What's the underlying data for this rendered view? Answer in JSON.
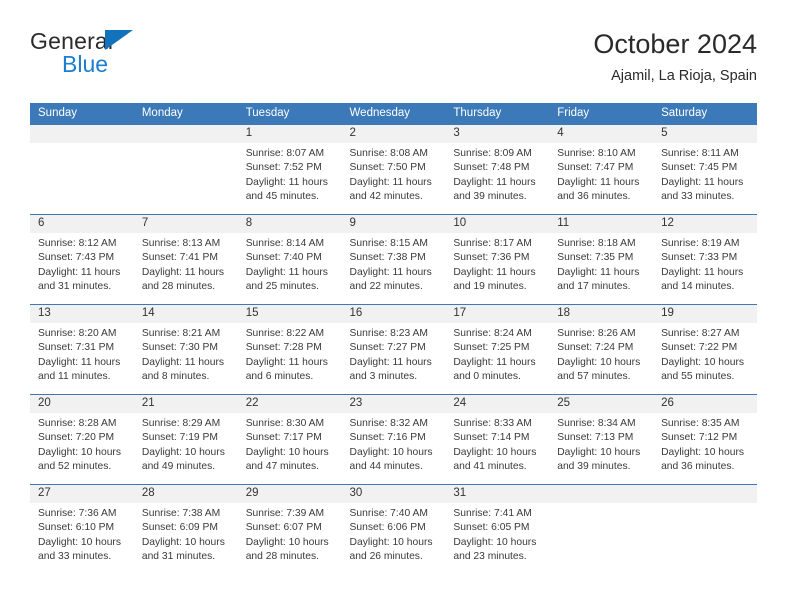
{
  "brand": {
    "line1": "General",
    "line2": "Blue",
    "triangle_color": "#1272bb",
    "blue_color": "#1b7ed1"
  },
  "header": {
    "title": "October 2024",
    "subtitle": "Ajamil, La Rioja, Spain"
  },
  "theme": {
    "header_blue": "#3b79b8",
    "daynum_band": "#f1f1f1",
    "text": "#3a3a3a"
  },
  "weekdays": [
    "Sunday",
    "Monday",
    "Tuesday",
    "Wednesday",
    "Thursday",
    "Friday",
    "Saturday"
  ],
  "labels": {
    "sunrise": "Sunrise:",
    "sunset": "Sunset:",
    "daylight": "Daylight:"
  },
  "weeks": [
    [
      {
        "day": "",
        "blank": true
      },
      {
        "day": "",
        "blank": true
      },
      {
        "day": "1",
        "sunrise": "Sunrise: 8:07 AM",
        "sunset": "Sunset: 7:52 PM",
        "daylight1": "Daylight: 11 hours",
        "daylight2": "and 45 minutes."
      },
      {
        "day": "2",
        "sunrise": "Sunrise: 8:08 AM",
        "sunset": "Sunset: 7:50 PM",
        "daylight1": "Daylight: 11 hours",
        "daylight2": "and 42 minutes."
      },
      {
        "day": "3",
        "sunrise": "Sunrise: 8:09 AM",
        "sunset": "Sunset: 7:48 PM",
        "daylight1": "Daylight: 11 hours",
        "daylight2": "and 39 minutes."
      },
      {
        "day": "4",
        "sunrise": "Sunrise: 8:10 AM",
        "sunset": "Sunset: 7:47 PM",
        "daylight1": "Daylight: 11 hours",
        "daylight2": "and 36 minutes."
      },
      {
        "day": "5",
        "sunrise": "Sunrise: 8:11 AM",
        "sunset": "Sunset: 7:45 PM",
        "daylight1": "Daylight: 11 hours",
        "daylight2": "and 33 minutes."
      }
    ],
    [
      {
        "day": "6",
        "sunrise": "Sunrise: 8:12 AM",
        "sunset": "Sunset: 7:43 PM",
        "daylight1": "Daylight: 11 hours",
        "daylight2": "and 31 minutes."
      },
      {
        "day": "7",
        "sunrise": "Sunrise: 8:13 AM",
        "sunset": "Sunset: 7:41 PM",
        "daylight1": "Daylight: 11 hours",
        "daylight2": "and 28 minutes."
      },
      {
        "day": "8",
        "sunrise": "Sunrise: 8:14 AM",
        "sunset": "Sunset: 7:40 PM",
        "daylight1": "Daylight: 11 hours",
        "daylight2": "and 25 minutes."
      },
      {
        "day": "9",
        "sunrise": "Sunrise: 8:15 AM",
        "sunset": "Sunset: 7:38 PM",
        "daylight1": "Daylight: 11 hours",
        "daylight2": "and 22 minutes."
      },
      {
        "day": "10",
        "sunrise": "Sunrise: 8:17 AM",
        "sunset": "Sunset: 7:36 PM",
        "daylight1": "Daylight: 11 hours",
        "daylight2": "and 19 minutes."
      },
      {
        "day": "11",
        "sunrise": "Sunrise: 8:18 AM",
        "sunset": "Sunset: 7:35 PM",
        "daylight1": "Daylight: 11 hours",
        "daylight2": "and 17 minutes."
      },
      {
        "day": "12",
        "sunrise": "Sunrise: 8:19 AM",
        "sunset": "Sunset: 7:33 PM",
        "daylight1": "Daylight: 11 hours",
        "daylight2": "and 14 minutes."
      }
    ],
    [
      {
        "day": "13",
        "sunrise": "Sunrise: 8:20 AM",
        "sunset": "Sunset: 7:31 PM",
        "daylight1": "Daylight: 11 hours",
        "daylight2": "and 11 minutes."
      },
      {
        "day": "14",
        "sunrise": "Sunrise: 8:21 AM",
        "sunset": "Sunset: 7:30 PM",
        "daylight1": "Daylight: 11 hours",
        "daylight2": "and 8 minutes."
      },
      {
        "day": "15",
        "sunrise": "Sunrise: 8:22 AM",
        "sunset": "Sunset: 7:28 PM",
        "daylight1": "Daylight: 11 hours",
        "daylight2": "and 6 minutes."
      },
      {
        "day": "16",
        "sunrise": "Sunrise: 8:23 AM",
        "sunset": "Sunset: 7:27 PM",
        "daylight1": "Daylight: 11 hours",
        "daylight2": "and 3 minutes."
      },
      {
        "day": "17",
        "sunrise": "Sunrise: 8:24 AM",
        "sunset": "Sunset: 7:25 PM",
        "daylight1": "Daylight: 11 hours",
        "daylight2": "and 0 minutes."
      },
      {
        "day": "18",
        "sunrise": "Sunrise: 8:26 AM",
        "sunset": "Sunset: 7:24 PM",
        "daylight1": "Daylight: 10 hours",
        "daylight2": "and 57 minutes."
      },
      {
        "day": "19",
        "sunrise": "Sunrise: 8:27 AM",
        "sunset": "Sunset: 7:22 PM",
        "daylight1": "Daylight: 10 hours",
        "daylight2": "and 55 minutes."
      }
    ],
    [
      {
        "day": "20",
        "sunrise": "Sunrise: 8:28 AM",
        "sunset": "Sunset: 7:20 PM",
        "daylight1": "Daylight: 10 hours",
        "daylight2": "and 52 minutes."
      },
      {
        "day": "21",
        "sunrise": "Sunrise: 8:29 AM",
        "sunset": "Sunset: 7:19 PM",
        "daylight1": "Daylight: 10 hours",
        "daylight2": "and 49 minutes."
      },
      {
        "day": "22",
        "sunrise": "Sunrise: 8:30 AM",
        "sunset": "Sunset: 7:17 PM",
        "daylight1": "Daylight: 10 hours",
        "daylight2": "and 47 minutes."
      },
      {
        "day": "23",
        "sunrise": "Sunrise: 8:32 AM",
        "sunset": "Sunset: 7:16 PM",
        "daylight1": "Daylight: 10 hours",
        "daylight2": "and 44 minutes."
      },
      {
        "day": "24",
        "sunrise": "Sunrise: 8:33 AM",
        "sunset": "Sunset: 7:14 PM",
        "daylight1": "Daylight: 10 hours",
        "daylight2": "and 41 minutes."
      },
      {
        "day": "25",
        "sunrise": "Sunrise: 8:34 AM",
        "sunset": "Sunset: 7:13 PM",
        "daylight1": "Daylight: 10 hours",
        "daylight2": "and 39 minutes."
      },
      {
        "day": "26",
        "sunrise": "Sunrise: 8:35 AM",
        "sunset": "Sunset: 7:12 PM",
        "daylight1": "Daylight: 10 hours",
        "daylight2": "and 36 minutes."
      }
    ],
    [
      {
        "day": "27",
        "sunrise": "Sunrise: 7:36 AM",
        "sunset": "Sunset: 6:10 PM",
        "daylight1": "Daylight: 10 hours",
        "daylight2": "and 33 minutes."
      },
      {
        "day": "28",
        "sunrise": "Sunrise: 7:38 AM",
        "sunset": "Sunset: 6:09 PM",
        "daylight1": "Daylight: 10 hours",
        "daylight2": "and 31 minutes."
      },
      {
        "day": "29",
        "sunrise": "Sunrise: 7:39 AM",
        "sunset": "Sunset: 6:07 PM",
        "daylight1": "Daylight: 10 hours",
        "daylight2": "and 28 minutes."
      },
      {
        "day": "30",
        "sunrise": "Sunrise: 7:40 AM",
        "sunset": "Sunset: 6:06 PM",
        "daylight1": "Daylight: 10 hours",
        "daylight2": "and 26 minutes."
      },
      {
        "day": "31",
        "sunrise": "Sunrise: 7:41 AM",
        "sunset": "Sunset: 6:05 PM",
        "daylight1": "Daylight: 10 hours",
        "daylight2": "and 23 minutes."
      },
      {
        "day": "",
        "blank": true
      },
      {
        "day": "",
        "blank": true
      }
    ]
  ]
}
